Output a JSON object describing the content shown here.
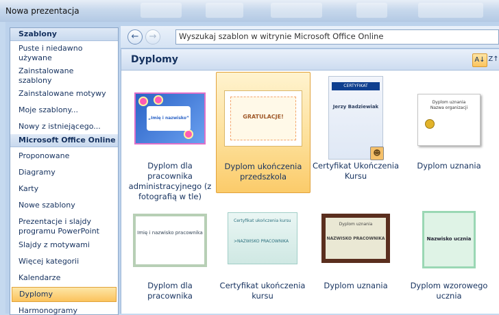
{
  "window": {
    "title": "Nowa prezentacja"
  },
  "sidebar": {
    "sections": [
      {
        "header": "Szablony",
        "items": [
          "Puste i niedawno używane",
          "Zainstalowane szablony",
          "Zainstalowane motywy",
          "Moje szablony...",
          "Nowy z istniejącego..."
        ]
      },
      {
        "header": "Microsoft Office Online",
        "items": [
          "Proponowane",
          "Diagramy",
          "Karty",
          "Nowe szablony",
          "Prezentacje i slajdy programu PowerPoint",
          "Slajdy z motywami",
          "Więcej kategorii",
          "Kalendarze",
          "Dyplomy",
          "Harmonogramy"
        ]
      }
    ],
    "selected": "Dyplomy"
  },
  "navbar": {
    "back_icon": "back-arrow-icon",
    "forward_icon": "forward-arrow-icon",
    "search_value": "Wyszukaj szablon w witrynie Microsoft Office Online"
  },
  "content": {
    "heading": "Dyplomy",
    "sort_icons": [
      "sort-az-icon",
      "sort-za-icon"
    ],
    "templates": [
      {
        "caption": "Dyplom dla pracownika administracyjnego (z fotografią w tle)",
        "thumb_text": "„Imię i nazwisko”"
      },
      {
        "caption": "Dyplom ukończenia przedszkola",
        "thumb_text": "GRATULACJE!"
      },
      {
        "caption": "Certyfikat Ukończenia Kursu",
        "thumb_text": "CERTYFIKAT",
        "thumb_name": "Jerzy Badziewiak"
      },
      {
        "caption": "Dyplom uznania",
        "thumb_text": "Dyplom uznania",
        "thumb_sub": "Nazwa organizacji"
      },
      {
        "caption": "Dyplom dla pracownika",
        "thumb_text": "Imię i nazwisko pracownika"
      },
      {
        "caption": "Certyfikat ukończenia kursu",
        "thumb_text": "Certyfikat ukończenia kursu",
        "thumb_sub": ">NAZWISKO PRACOWNIKA"
      },
      {
        "caption": "Dyplom uznania",
        "thumb_text": "Dyplom uznania",
        "thumb_sub": "NAZWISKO PRACOWNIKA"
      },
      {
        "caption": "Dyplom wzorowego ucznia",
        "thumb_text": "Nazwisko ucznia"
      }
    ],
    "selected_index": 1
  },
  "colors": {
    "accent": "#15315e",
    "selection": "#fbc35d",
    "header_bg": "#cddcf0"
  }
}
